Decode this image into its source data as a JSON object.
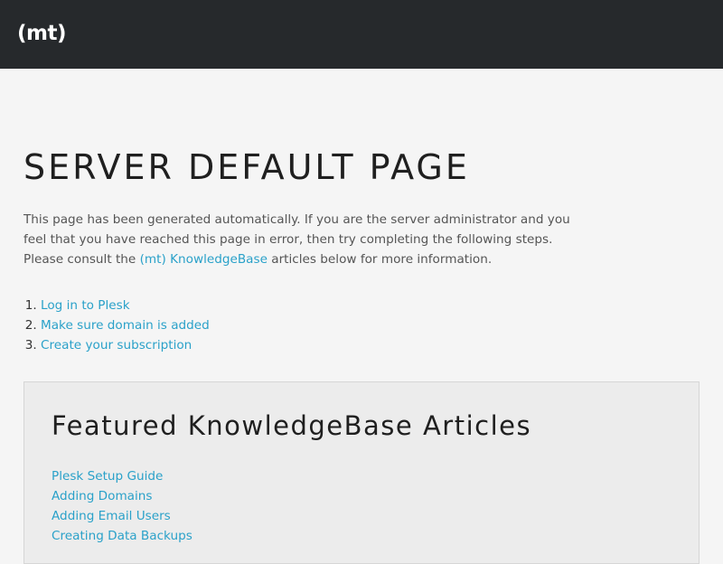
{
  "header": {
    "logo_text": "(mt)"
  },
  "main": {
    "title": "SERVER DEFAULT PAGE",
    "intro_before_link": "This page has been generated automatically. If you are the server administrator and you feel that you have reached this page in error, then try completing the following steps. Please consult the ",
    "intro_link": "(mt) KnowledgeBase",
    "intro_after_link": " articles below for more information.",
    "steps": [
      "Log in to Plesk",
      "Make sure domain is added",
      "Create your subscription"
    ]
  },
  "featured": {
    "title": "Featured KnowledgeBase Articles",
    "articles": [
      "Plesk Setup Guide",
      "Adding Domains",
      "Adding Email Users",
      "Creating Data Backups"
    ]
  },
  "colors": {
    "header_bg": "#26292c",
    "page_bg": "#f5f5f5",
    "link": "#2aa1c9",
    "box_bg": "#ececec"
  }
}
